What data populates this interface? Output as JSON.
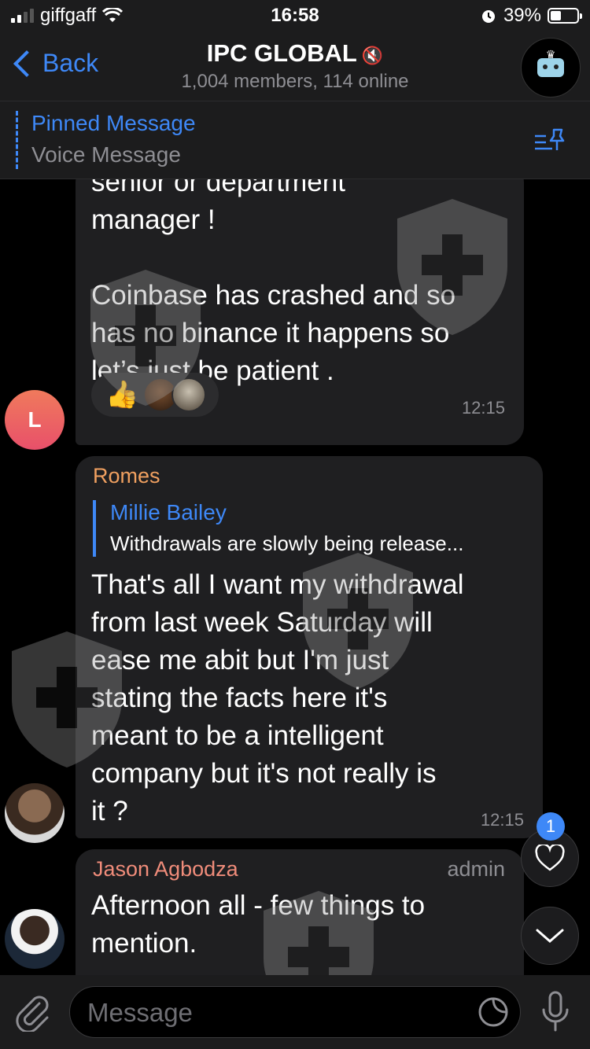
{
  "status_bar": {
    "carrier": "giffgaff",
    "time": "16:58",
    "battery": "39%"
  },
  "header": {
    "back_label": "Back",
    "title": "IPC GLOBAL",
    "subtitle": "1,004 members, 114 online"
  },
  "pinned": {
    "title": "Pinned Message",
    "text": "Voice Message"
  },
  "messages": [
    {
      "text": "senior or department\nmanager !\n\nCoinbase has crashed and so\nhas no binance it happens so\nlet’s just be patient .",
      "time": "12:15",
      "avatar_initial": "L",
      "reaction_emoji": "👍"
    },
    {
      "sender": "Romes",
      "reply_name": "Millie Bailey",
      "reply_text": "Withdrawals are slowly being release...",
      "text": "That's all I want my withdrawal\nfrom last week Saturday will\nease me abit but I'm just\nstating the facts here it's\nmeant to be a intelligent\ncompany but it's not really is\nit ?",
      "time": "12:15"
    },
    {
      "sender": "Jason Agbodza",
      "role": "admin",
      "text": "Afternoon all - few things to\nmention."
    }
  ],
  "unread_badge": "1",
  "composer": {
    "placeholder": "Message"
  },
  "colors": {
    "accent": "#3e88f7",
    "bubble": "#1f1f21",
    "romes": "#f0a060",
    "jason": "#f08c7a"
  }
}
